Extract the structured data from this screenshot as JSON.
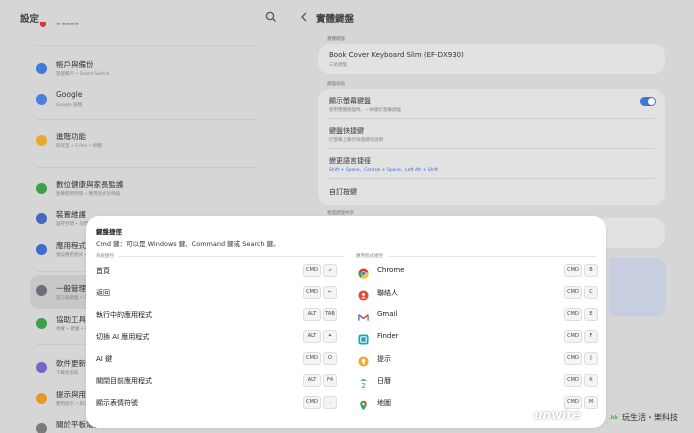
{
  "left": {
    "title": "設定",
    "items": [
      {
        "title": "帳戶與備份",
        "sub": "管理帳戶 • Smart Switch",
        "color": "#3f7bd8"
      },
      {
        "title": "Google",
        "sub": "Google 服務",
        "color": "#4a7fe0"
      },
      {
        "title": "進階功能",
        "sub": "研究室 • S Pen • 側鍵",
        "color": "#e9a92a"
      },
      {
        "title": "數位健康與家長監護",
        "sub": "螢幕使用時間 • 應用程式計時器",
        "color": "#3fa04a"
      },
      {
        "title": "裝置維護",
        "sub": "儲存空間 • 記憶體 • 應用程式保護",
        "color": "#4668b8"
      },
      {
        "title": "應用程式",
        "sub": "預設應用程式 • 應用程式設定",
        "color": "#3d6ccf"
      },
      {
        "title": "一般管理",
        "sub": "語言與鍵盤 • 日期與時間",
        "color": "#6a6f7a"
      },
      {
        "title": "協助工具",
        "sub": "視覺 • 聽覺 • 操控",
        "color": "#3fa04a"
      },
      {
        "title": "軟件更新",
        "sub": "下載並安裝",
        "color": "#7d62c8"
      },
      {
        "title": "提示與用戶手冊",
        "sub": "實用提示 • 新功能",
        "color": "#e29a2a"
      },
      {
        "title": "關於平板電腦",
        "sub": "",
        "color": "#7a7a7a"
      }
    ]
  },
  "right": {
    "title": "實體鍵盤",
    "section1": "實體鍵盤",
    "keyboard_name": "Book Cover Keyboard Slim (EF-DX930)",
    "keyboard_sub": "三星鍵盤",
    "section2": "鍵盤協助",
    "show_kb": "顯示螢幕鍵盤",
    "show_kb_sub": "使用實體鍵盤時，一併顯示螢幕鍵盤",
    "shortcuts": "鍵盤快捷鍵",
    "shortcuts_sub": "於螢幕上顯示快捷鍵的說明",
    "lang_switch": "變更語言捷徑",
    "lang_switch_sub": "Shift + Space、Control + Space、Left Alt + Shift",
    "custom_keys": "自訂按鍵",
    "section3": "物理鍵盤共享"
  },
  "dialog": {
    "title": "鍵盤捷徑",
    "cmd_note": "Cmd 鍵：可以是 Windows 鍵、Command 鍵或 Search 鍵。",
    "system_header": "系統捷徑",
    "app_header": "應用程式捷徑",
    "system_rows": [
      {
        "label": "首頁",
        "k1": "CMD",
        "k2": "⤶"
      },
      {
        "label": "返回",
        "k1": "CMD",
        "k2": "←"
      },
      {
        "label": "執行中的應用程式",
        "k1": "ALT",
        "k2": "TAB"
      },
      {
        "label": "切換 AI 應用程式",
        "k1": "ALT",
        "k2": "✦"
      },
      {
        "label": "AI 鍵",
        "k1": "CMD",
        "k2": "O"
      },
      {
        "label": "關閉目前應用程式",
        "k1": "ALT",
        "k2": "F4"
      },
      {
        "label": "顯示表情符號",
        "k1": "CMD",
        "k2": "."
      }
    ],
    "app_rows": [
      {
        "label": "Chrome",
        "k1": "CMD",
        "k2": "B",
        "icon": "chrome-icon"
      },
      {
        "label": "聯絡人",
        "k1": "CMD",
        "k2": "C",
        "icon": "contacts-icon"
      },
      {
        "label": "Gmail",
        "k1": "CMD",
        "k2": "E",
        "icon": "gmail-icon"
      },
      {
        "label": "Finder",
        "k1": "CMD",
        "k2": "F",
        "icon": "finder-icon"
      },
      {
        "label": "提示",
        "k1": "CMD",
        "k2": "J",
        "icon": "tips-icon"
      },
      {
        "label": "日曆",
        "k1": "CMD",
        "k2": "K",
        "icon": "calendar-icon"
      },
      {
        "label": "地圖",
        "k1": "CMD",
        "k2": "M",
        "icon": "maps-icon"
      }
    ]
  },
  "watermark": {
    "brand": "unwire",
    "hk": ".hk",
    "tagline": "玩生活・樂科技"
  },
  "colors": {
    "accent": "#3b76d8",
    "chrome_red": "#e53935",
    "gmail_red": "#d93025"
  }
}
